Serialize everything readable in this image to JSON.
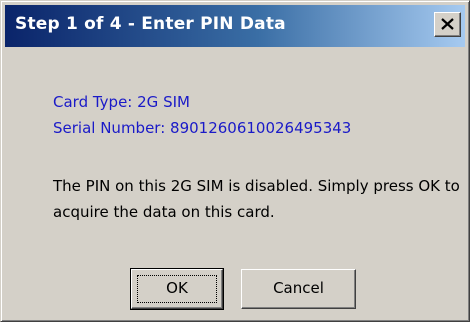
{
  "dialog": {
    "title": "Step 1 of 4 - Enter PIN Data",
    "card_type": "Card Type: 2G SIM",
    "serial_number": "Serial Number: 8901260610026495343",
    "message": "The PIN on this 2G SIM is disabled. Simply press OK to acquire the data on this card.",
    "ok_label": "OK",
    "cancel_label": "Cancel",
    "close_icon": "close-icon"
  },
  "colors": {
    "titlebar_start": "#0a246a",
    "titlebar_end": "#a6caf0",
    "info_text": "#1a1ac8",
    "dialog_bg": "#d4d0c8"
  }
}
